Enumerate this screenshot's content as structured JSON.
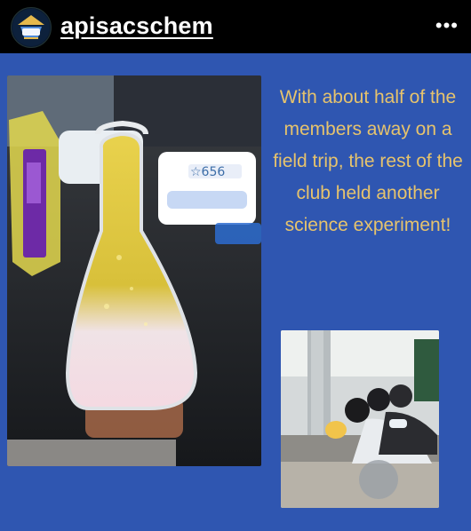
{
  "header": {
    "username": "apisacschem",
    "more_label": "•••"
  },
  "post": {
    "caption": "With about half of the members away on a field trip, the rest of the club held another science experiment!",
    "photo1": {
      "label_text": "☆656"
    },
    "colors": {
      "background": "#2f56b1",
      "caption": "#e6c36d"
    }
  }
}
